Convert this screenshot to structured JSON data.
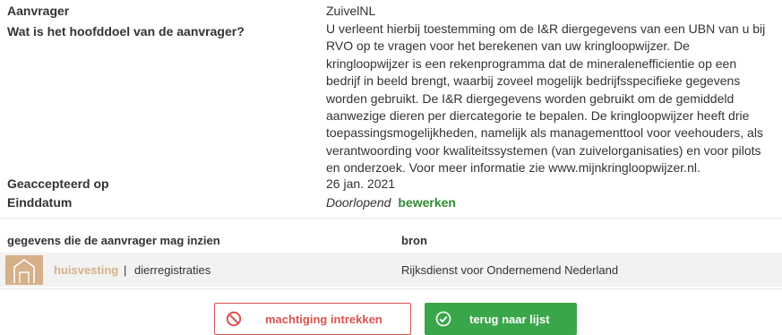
{
  "details": {
    "applicant_label": "Aanvrager",
    "applicant_value": "ZuivelNL",
    "purpose_label": "Wat is het hoofddoel van de aanvrager?",
    "purpose_lines": [
      "U verleent hierbij toestemming om de I&R diergegevens van een UBN van u bij",
      "RVO op te vragen voor het berekenen van uw kringloopwijzer. De",
      "kringloopwijzer is een rekenprogramma dat de mineralenefficientie op een",
      "bedrijf in beeld brengt, waarbij zoveel mogelijk bedrijfsspecifieke gegevens",
      "worden gebruikt. De I&R diergegevens worden gebruikt om de gemiddeld",
      "aanwezige dieren per diercategorie te bepalen. De kringloopwijzer heeft drie",
      "toepassingsmogelijkheden, namelijk als managementtool voor veehouders, als",
      "verantwoording voor kwaliteitssystemen (van zuivelorganisaties) en voor pilots",
      "en onderzoek. Voor meer informatie zie www.mijnkringloopwijzer.nl."
    ],
    "accepted_label": "Geaccepteerd op",
    "accepted_value": "26 jan. 2021",
    "end_label": "Einddatum",
    "end_value": "Doorlopend",
    "edit_link": "bewerken"
  },
  "table": {
    "col_data": "gegevens die de aanvrager mag inzien",
    "col_source": "bron",
    "rows": [
      {
        "icon": "barn-icon",
        "name": "huisvesting",
        "separator": "|",
        "sub": "dierregistraties",
        "source": "Rijksdienst voor Ondernemend Nederland"
      }
    ]
  },
  "actions": {
    "revoke_label": "machtiging intrekken",
    "back_label": "terug naar lijst"
  },
  "colors": {
    "accent_green": "#3aa64a",
    "danger_red": "#d9534f",
    "tan": "#d5b089"
  }
}
